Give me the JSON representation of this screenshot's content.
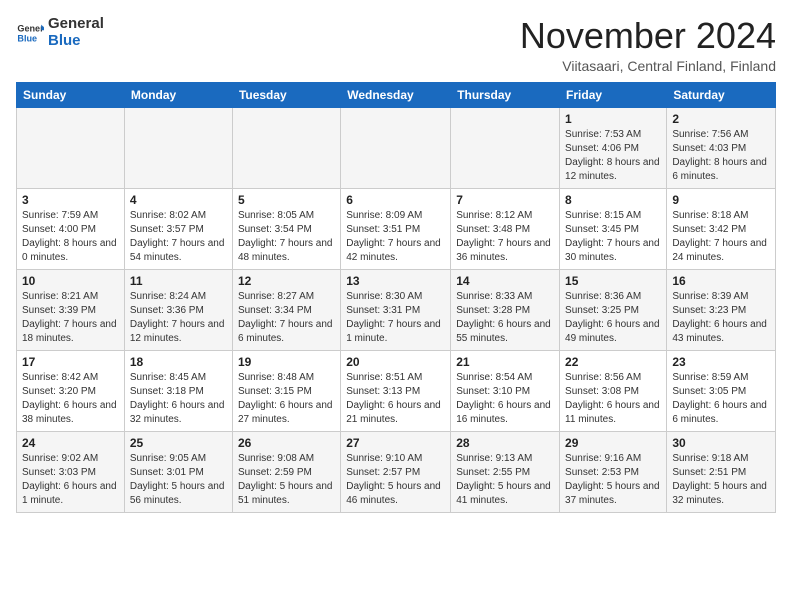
{
  "logo": {
    "general": "General",
    "blue": "Blue"
  },
  "title": "November 2024",
  "subtitle": "Viitasaari, Central Finland, Finland",
  "weekdays": [
    "Sunday",
    "Monday",
    "Tuesday",
    "Wednesday",
    "Thursday",
    "Friday",
    "Saturday"
  ],
  "weeks": [
    [
      {
        "day": "",
        "info": ""
      },
      {
        "day": "",
        "info": ""
      },
      {
        "day": "",
        "info": ""
      },
      {
        "day": "",
        "info": ""
      },
      {
        "day": "",
        "info": ""
      },
      {
        "day": "1",
        "info": "Sunrise: 7:53 AM\nSunset: 4:06 PM\nDaylight: 8 hours and 12 minutes."
      },
      {
        "day": "2",
        "info": "Sunrise: 7:56 AM\nSunset: 4:03 PM\nDaylight: 8 hours and 6 minutes."
      }
    ],
    [
      {
        "day": "3",
        "info": "Sunrise: 7:59 AM\nSunset: 4:00 PM\nDaylight: 8 hours and 0 minutes."
      },
      {
        "day": "4",
        "info": "Sunrise: 8:02 AM\nSunset: 3:57 PM\nDaylight: 7 hours and 54 minutes."
      },
      {
        "day": "5",
        "info": "Sunrise: 8:05 AM\nSunset: 3:54 PM\nDaylight: 7 hours and 48 minutes."
      },
      {
        "day": "6",
        "info": "Sunrise: 8:09 AM\nSunset: 3:51 PM\nDaylight: 7 hours and 42 minutes."
      },
      {
        "day": "7",
        "info": "Sunrise: 8:12 AM\nSunset: 3:48 PM\nDaylight: 7 hours and 36 minutes."
      },
      {
        "day": "8",
        "info": "Sunrise: 8:15 AM\nSunset: 3:45 PM\nDaylight: 7 hours and 30 minutes."
      },
      {
        "day": "9",
        "info": "Sunrise: 8:18 AM\nSunset: 3:42 PM\nDaylight: 7 hours and 24 minutes."
      }
    ],
    [
      {
        "day": "10",
        "info": "Sunrise: 8:21 AM\nSunset: 3:39 PM\nDaylight: 7 hours and 18 minutes."
      },
      {
        "day": "11",
        "info": "Sunrise: 8:24 AM\nSunset: 3:36 PM\nDaylight: 7 hours and 12 minutes."
      },
      {
        "day": "12",
        "info": "Sunrise: 8:27 AM\nSunset: 3:34 PM\nDaylight: 7 hours and 6 minutes."
      },
      {
        "day": "13",
        "info": "Sunrise: 8:30 AM\nSunset: 3:31 PM\nDaylight: 7 hours and 1 minute."
      },
      {
        "day": "14",
        "info": "Sunrise: 8:33 AM\nSunset: 3:28 PM\nDaylight: 6 hours and 55 minutes."
      },
      {
        "day": "15",
        "info": "Sunrise: 8:36 AM\nSunset: 3:25 PM\nDaylight: 6 hours and 49 minutes."
      },
      {
        "day": "16",
        "info": "Sunrise: 8:39 AM\nSunset: 3:23 PM\nDaylight: 6 hours and 43 minutes."
      }
    ],
    [
      {
        "day": "17",
        "info": "Sunrise: 8:42 AM\nSunset: 3:20 PM\nDaylight: 6 hours and 38 minutes."
      },
      {
        "day": "18",
        "info": "Sunrise: 8:45 AM\nSunset: 3:18 PM\nDaylight: 6 hours and 32 minutes."
      },
      {
        "day": "19",
        "info": "Sunrise: 8:48 AM\nSunset: 3:15 PM\nDaylight: 6 hours and 27 minutes."
      },
      {
        "day": "20",
        "info": "Sunrise: 8:51 AM\nSunset: 3:13 PM\nDaylight: 6 hours and 21 minutes."
      },
      {
        "day": "21",
        "info": "Sunrise: 8:54 AM\nSunset: 3:10 PM\nDaylight: 6 hours and 16 minutes."
      },
      {
        "day": "22",
        "info": "Sunrise: 8:56 AM\nSunset: 3:08 PM\nDaylight: 6 hours and 11 minutes."
      },
      {
        "day": "23",
        "info": "Sunrise: 8:59 AM\nSunset: 3:05 PM\nDaylight: 6 hours and 6 minutes."
      }
    ],
    [
      {
        "day": "24",
        "info": "Sunrise: 9:02 AM\nSunset: 3:03 PM\nDaylight: 6 hours and 1 minute."
      },
      {
        "day": "25",
        "info": "Sunrise: 9:05 AM\nSunset: 3:01 PM\nDaylight: 5 hours and 56 minutes."
      },
      {
        "day": "26",
        "info": "Sunrise: 9:08 AM\nSunset: 2:59 PM\nDaylight: 5 hours and 51 minutes."
      },
      {
        "day": "27",
        "info": "Sunrise: 9:10 AM\nSunset: 2:57 PM\nDaylight: 5 hours and 46 minutes."
      },
      {
        "day": "28",
        "info": "Sunrise: 9:13 AM\nSunset: 2:55 PM\nDaylight: 5 hours and 41 minutes."
      },
      {
        "day": "29",
        "info": "Sunrise: 9:16 AM\nSunset: 2:53 PM\nDaylight: 5 hours and 37 minutes."
      },
      {
        "day": "30",
        "info": "Sunrise: 9:18 AM\nSunset: 2:51 PM\nDaylight: 5 hours and 32 minutes."
      }
    ]
  ]
}
